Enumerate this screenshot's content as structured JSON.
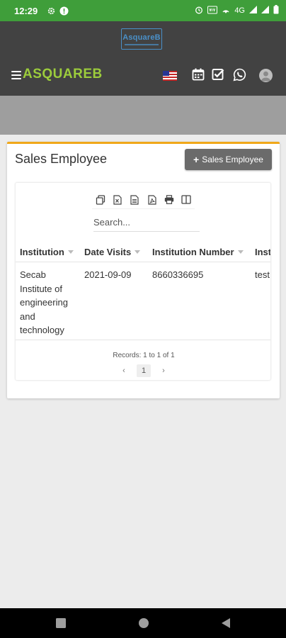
{
  "status_bar": {
    "time": "12:29",
    "network": "4G",
    "icons": [
      "settings-icon",
      "alert-icon",
      "alarm-icon",
      "vowifi-icon",
      "hotspot-icon",
      "signal-icon",
      "battery-icon"
    ]
  },
  "header": {
    "logo_text": "AsquareB",
    "brand": "ASQUAREB",
    "icons": [
      "menu-icon",
      "us-flag-icon",
      "calendar-icon",
      "checkbox-icon",
      "whatsapp-icon",
      "user-avatar-icon"
    ]
  },
  "card": {
    "title": "Sales Employee",
    "add_button_label": "Sales Employee",
    "accent_color": "#f0a81a"
  },
  "toolbar": {
    "icons": [
      "copy-icon",
      "excel-icon",
      "csv-icon",
      "pdf-icon",
      "print-icon",
      "columns-icon"
    ]
  },
  "search": {
    "placeholder": "Search..."
  },
  "table": {
    "columns": [
      "Institution",
      "Date Visits",
      "Institution Number",
      "Inst"
    ],
    "rows": [
      {
        "institution_lines": [
          "Secab",
          "Institute of",
          "engineering",
          "and",
          "technology"
        ],
        "date_visits": "2021-09-09",
        "institution_number": "8660336695",
        "inst": "test"
      }
    ]
  },
  "pagination": {
    "records_text": "Records: 1 to 1 of 1",
    "prev": "‹",
    "current_page": "1",
    "next": "›"
  },
  "colors": {
    "status_bar": "#3f9e3a",
    "header": "#424242",
    "brand": "#9ccc3c",
    "banner": "#9e9e9e"
  }
}
